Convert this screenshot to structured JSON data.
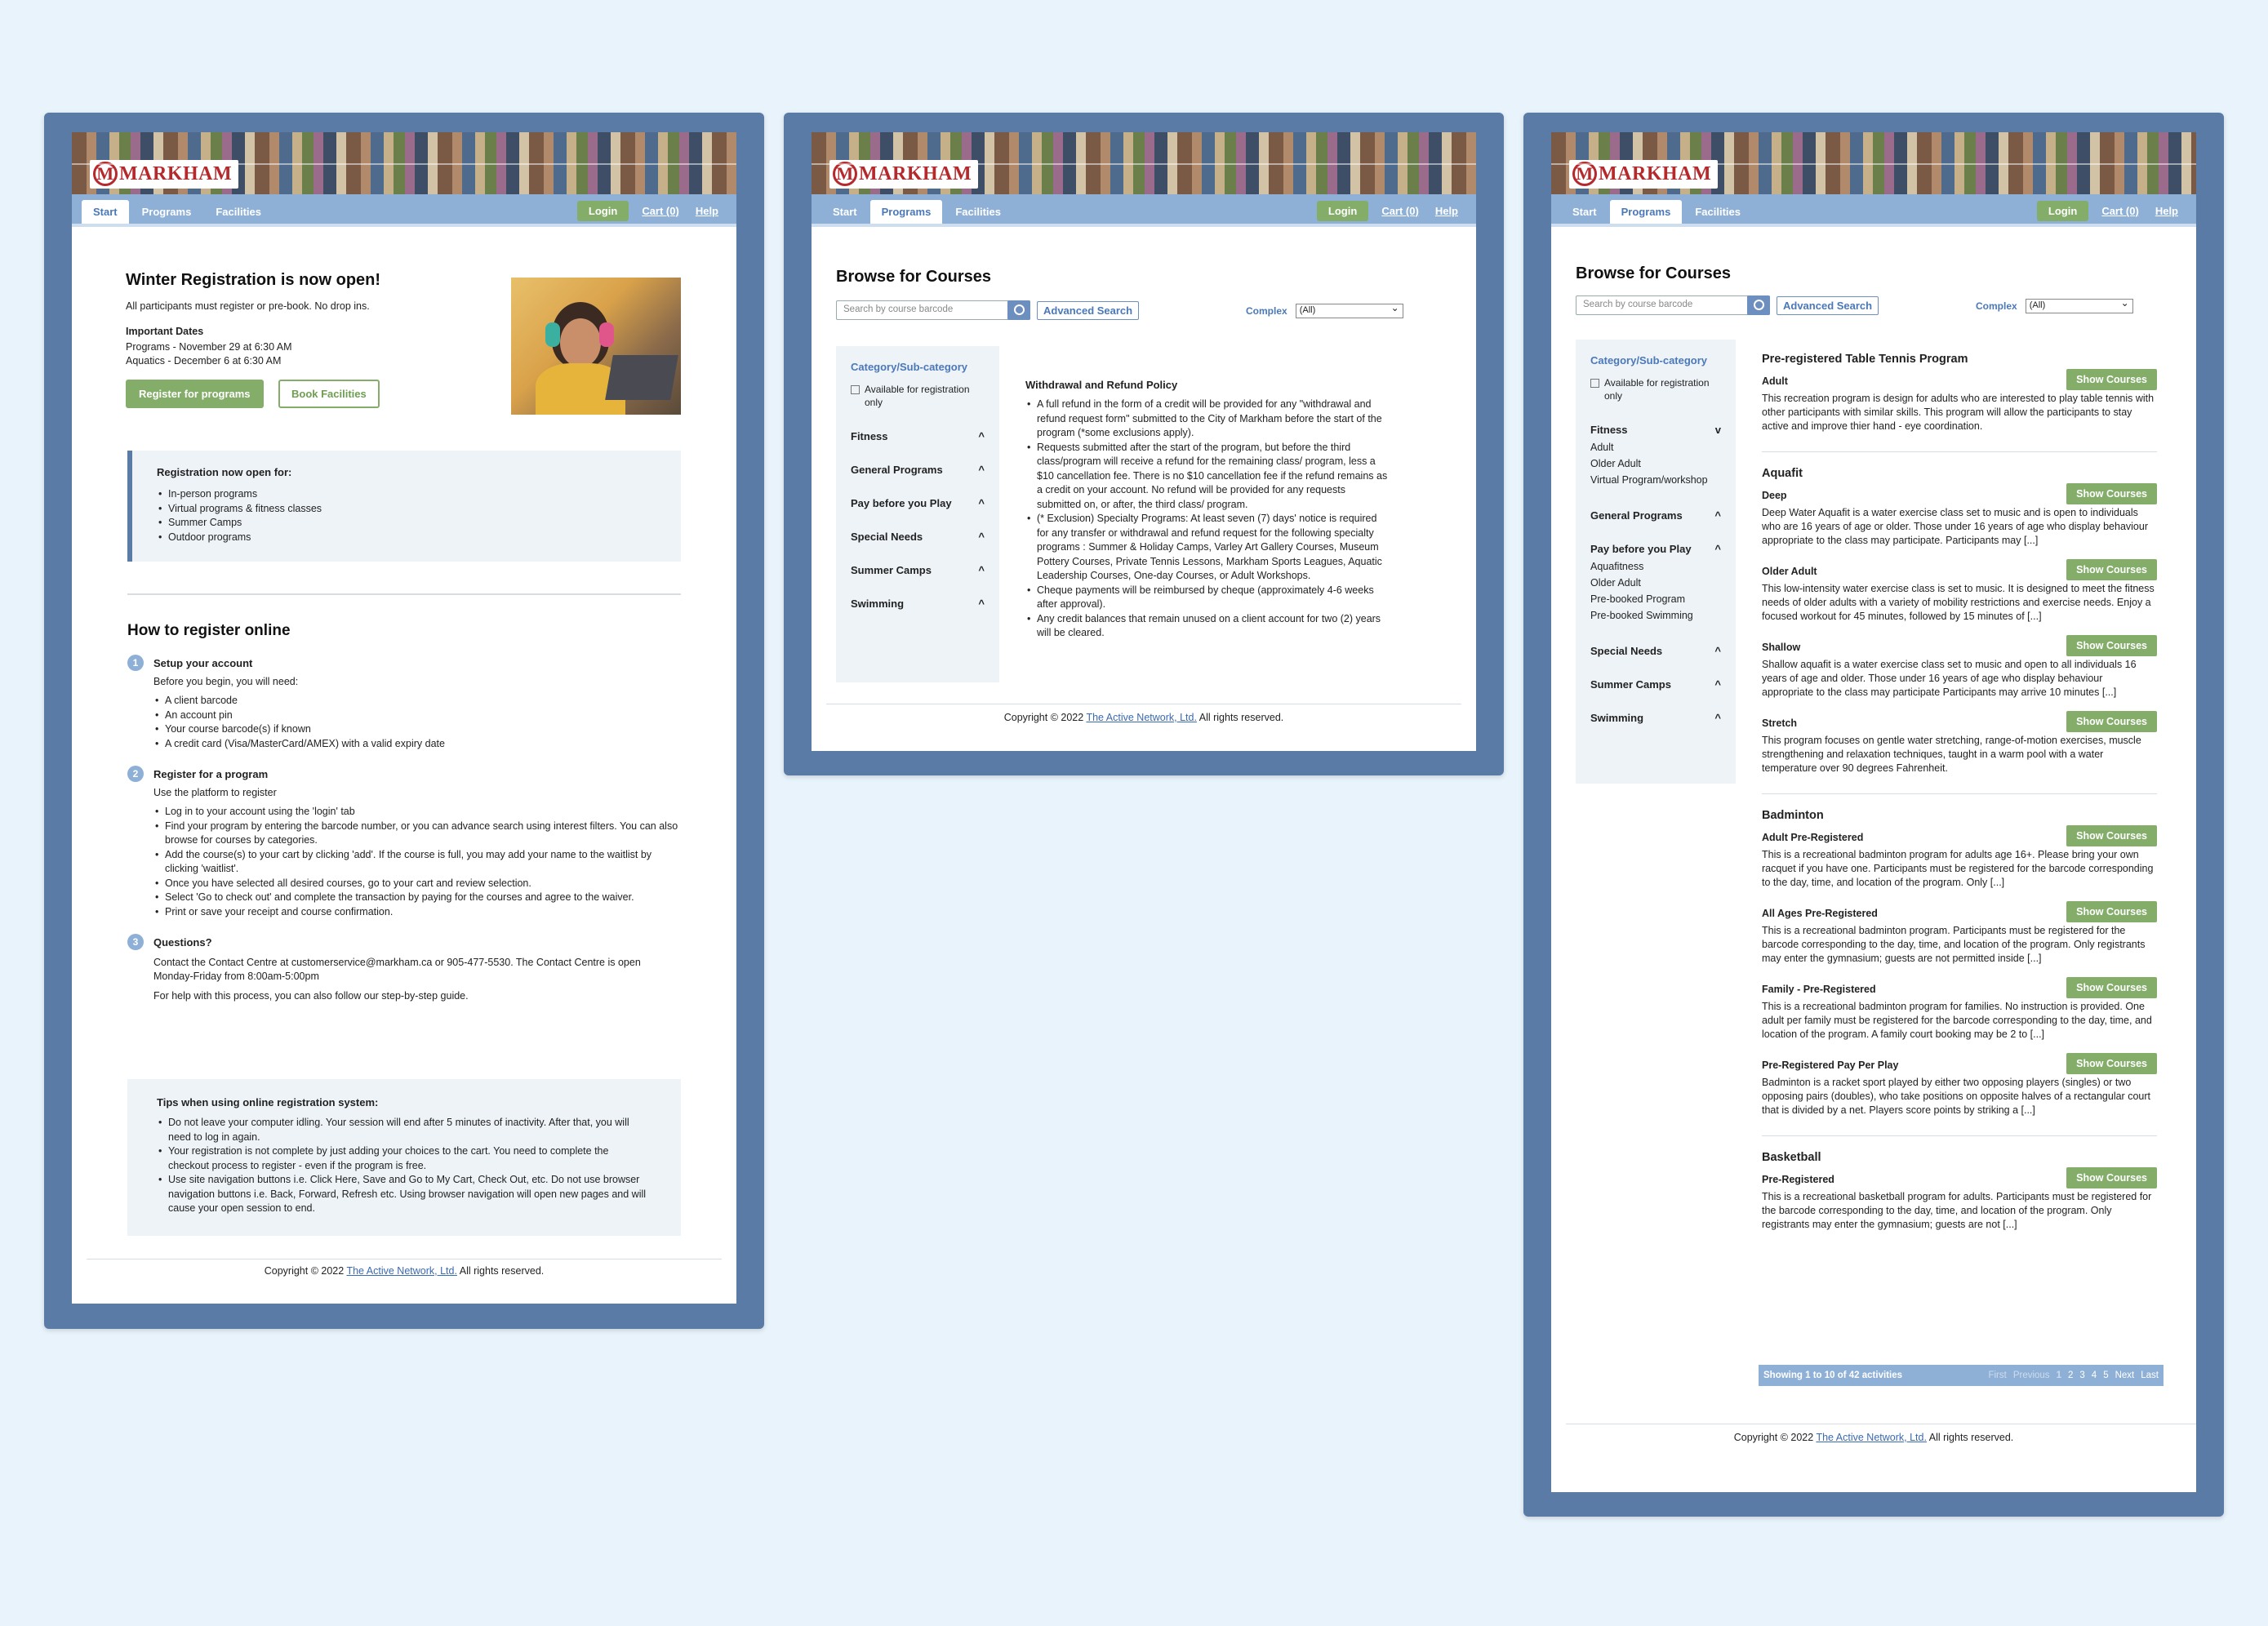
{
  "shared": {
    "logo_text": "MARKHAM",
    "tabs": [
      "Start",
      "Programs",
      "Facilities"
    ],
    "login_label": "Login",
    "cart_label": "Cart (0)",
    "help_label": "Help",
    "footer": {
      "prefix": "Copyright © 2022",
      "link": "The Active Network, Ltd.",
      "suffix": "All rights reserved."
    }
  },
  "start": {
    "title": "Winter Registration is now open!",
    "subtitle": "All participants must register or pre-book. No drop ins.",
    "dates_heading": "Important Dates",
    "dates": [
      "Programs - November 29 at 6:30 AM",
      "Aquatics - December 6 at 6:30 AM"
    ],
    "register_button": "Register for programs",
    "book_button": "Book Facilities",
    "open_heading": "Registration now open for:",
    "open_items": [
      "In-person programs",
      "Virtual programs & fitness classes",
      "Summer Camps",
      "Outdoor programs"
    ],
    "how_title": "How to register online",
    "steps": [
      {
        "num": "1",
        "title": "Setup your account",
        "intro": "Before you begin, you will need:",
        "items": [
          "A client barcode",
          "An account pin",
          "Your course barcode(s) if known",
          "A credit card (Visa/MasterCard/AMEX) with a valid expiry date"
        ]
      },
      {
        "num": "2",
        "title": "Register for a program",
        "intro": "Use the platform to register",
        "items": [
          "Log in to your account using the 'login' tab",
          "Find your program by entering the barcode number, or you can advance search using interest filters. You can also browse for courses by categories.",
          "Add the course(s) to your cart by clicking 'add'. If the course is full, you may add your name to the waitlist by clicking 'waitlist'.",
          "Once you have selected all desired courses, go to your cart and review selection.",
          "Select 'Go to check out' and complete the transaction by paying for the courses and agree to the waiver.",
          "Print or save your receipt and course confirmation."
        ]
      },
      {
        "num": "3",
        "title": "Questions?",
        "p1": "Contact the Contact Centre at customerservice@markham.ca or 905-477-5530. The Contact Centre is open Monday-Friday from 8:00am-5:00pm",
        "p2": "For help with this process, you can also follow our step-by-step guide."
      }
    ],
    "tips_heading": "Tips when using online registration system:",
    "tips": [
      "Do not leave your computer idling. Your session will end after 5 minutes of inactivity. After that, you will need to log in again.",
      "Your registration is not complete by just adding your choices to the cart. You need to complete the checkout process to register - even if the program is free.",
      "Use site navigation buttons i.e. Click Here, Save and Go to My Cart, Check Out, etc. Do not use browser navigation buttons i.e. Back, Forward, Refresh etc. Using browser navigation will open new pages and will cause your open session to end."
    ]
  },
  "browse": {
    "title": "Browse for Courses",
    "search_placeholder": "Search by course barcode",
    "advanced_search": "Advanced Search",
    "complex_label": "Complex",
    "complex_value": "(All)",
    "sidebar_heading": "Category/Sub-category",
    "available_label": "Available for registration only",
    "categories": [
      "Fitness",
      "General Programs",
      "Pay before you Play",
      "Special Needs",
      "Summer Camps",
      "Swimming"
    ],
    "policy_title": "Withdrawal and Refund Policy",
    "policy_items": [
      "A full refund in the form of a credit will be provided for any \"withdrawal and refund request form\" submitted to the City of Markham before the start of the program (*some exclusions apply).",
      "Requests submitted after the start of the program, but before the third class/program will receive a refund for the remaining class/ program, less a $10 cancellation fee. There is no $10 cancellation fee if the refund remains as a credit on your account. No refund will be provided for any requests submitted on, or after, the third class/ program.",
      "(* Exclusion) Specialty Programs: At least seven (7) days' notice is required for any transfer or withdrawal and refund request for the following specialty programs : Summer & Holiday Camps, Varley Art Gallery Courses, Museum Pottery Courses, Private Tennis Lessons, Markham Sports Leagues, Aquatic Leadership Courses, One-day Courses, or Adult Workshops.",
      "Cheque payments will be reimbursed by cheque (approximately 4-6 weeks after approval).",
      "Any credit balances that remain unused on a client account for two (2) years will be cleared."
    ]
  },
  "browse2": {
    "sidebar": [
      {
        "name": "Fitness",
        "chev": "v",
        "subs": [
          "Adult",
          "Older Adult",
          "Virtual Program/workshop"
        ]
      },
      {
        "name": "General Programs",
        "chev": "^",
        "subs": []
      },
      {
        "name": "Pay before you Play",
        "chev": "^",
        "subs": [
          "Aquafitness",
          "Older Adult",
          "Pre-booked Program",
          "Pre-booked Swimming"
        ]
      },
      {
        "name": "Special Needs",
        "chev": "^",
        "subs": []
      },
      {
        "name": "Summer Camps",
        "chev": "^",
        "subs": []
      },
      {
        "name": "Swimming",
        "chev": "^",
        "subs": []
      }
    ],
    "show_courses": "Show Courses",
    "groups": [
      {
        "title": "Pre-registered Table Tennis Program",
        "items": [
          {
            "sub": "Adult",
            "desc": "This recreation program is design for adults who are interested to play table tennis with other participants with similar skills. This program will allow the participants to stay active and improve thier hand - eye coordination."
          }
        ]
      },
      {
        "title": "Aquafit",
        "items": [
          {
            "sub": "Deep",
            "desc": "Deep Water Aquafit is a water exercise class set to music and is open to individuals who are 16 years of age or older. Those under 16 years of age who display behaviour appropriate to the class may participate. Participants may [...]"
          },
          {
            "sub": "Older Adult",
            "desc": "This low-intensity water exercise class is set to music. It is designed to meet the fitness needs of older adults with a variety of mobility restrictions and exercise needs. Enjoy a focused workout for 45 minutes, followed by 15 minutes of [...]"
          },
          {
            "sub": "Shallow",
            "desc": "Shallow aquafit is a water exercise class set to music and open to all individuals 16 years of age and older. Those under 16 years of age who display behaviour appropriate to the class may participate Participants may arrive 10 minutes [...]"
          },
          {
            "sub": "Stretch",
            "desc": "This program focuses on gentle water stretching, range-of-motion exercises, muscle strengthening and relaxation techniques, taught in a warm pool with a water temperature over 90 degrees Fahrenheit."
          }
        ]
      },
      {
        "title": "Badminton",
        "items": [
          {
            "sub": "Adult Pre-Registered",
            "desc": "This is a recreational badminton program for adults age 16+. Please bring your own racquet if you have one. Participants must be registered for the barcode corresponding to the day, time, and location of the program. Only [...]"
          },
          {
            "sub": "All Ages Pre-Registered",
            "desc": "This is a recreational badminton program. Participants must be registered for the barcode corresponding to the day, time, and location of the program. Only registrants may enter the gymnasium; guests are not permitted inside [...]"
          },
          {
            "sub": "Family - Pre-Registered",
            "desc": "This is a recreational badminton program for families. No instruction is provided. One adult per family must be registered for the barcode corresponding to the day, time, and location of the program. A family court booking may be 2 to [...]"
          },
          {
            "sub": "Pre-Registered Pay Per Play",
            "desc": "Badminton is a racket sport played by either two opposing players (singles) or two opposing pairs (doubles), who take positions on opposite halves of a rectangular court that is divided by a net. Players score points by striking a [...]"
          }
        ]
      },
      {
        "title": "Basketball",
        "items": [
          {
            "sub": "Pre-Registered",
            "desc": "This is a recreational basketball program for adults. Participants must be registered for the barcode corresponding to the day, time, and location of the program. Only registrants may enter the gymnasium; guests are not [...]"
          }
        ]
      }
    ],
    "pagination": {
      "summary": "Showing 1 to 10 of 42 activities",
      "links": [
        "First",
        "Previous",
        "1",
        "2",
        "3",
        "4",
        "5",
        "Next",
        "Last"
      ]
    }
  }
}
